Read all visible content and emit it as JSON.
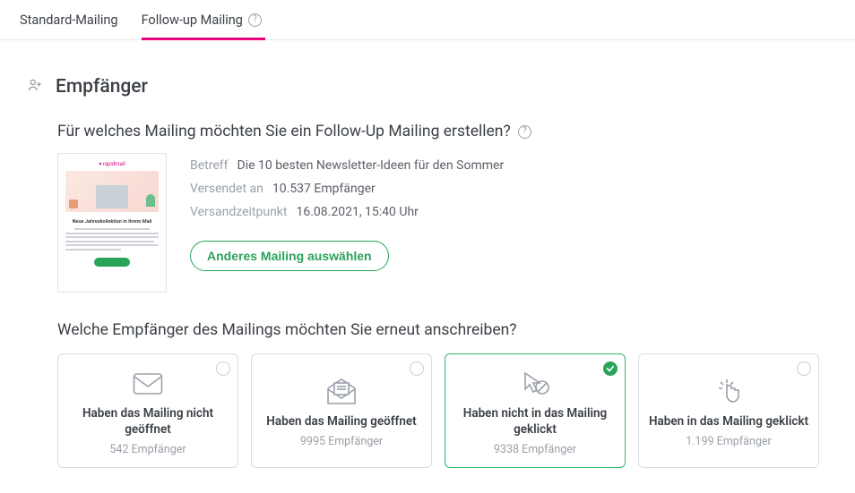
{
  "tabs": {
    "standard": "Standard-Mailing",
    "followup": "Follow-up Mailing"
  },
  "section": {
    "title": "Empfänger"
  },
  "question1": "Für welches Mailing möchten Sie ein Follow-Up Mailing erstellen?",
  "mailing": {
    "betreff_label": "Betreff",
    "betreff_value": "Die 10 besten Newsletter-Ideen für den Sommer",
    "versendet_label": "Versendet an",
    "versendet_value": "10.537 Empfänger",
    "zeit_label": "Versandzeitpunkt",
    "zeit_value": "16.08.2021, 15:40 Uhr",
    "choose_btn": "Anderes Mailing auswählen",
    "preview_headline": "Neue Jahreskollektion in Ihrem Mail"
  },
  "question2": "Welche Empfänger des Mailings möchten Sie erneut anschreiben?",
  "cards": [
    {
      "title": "Haben das Mailing nicht geöffnet",
      "sub": "542 Empfänger",
      "selected": false
    },
    {
      "title": "Haben das Mailing geöffnet",
      "sub": "9995 Empfänger",
      "selected": false
    },
    {
      "title": "Haben nicht in das Mailing geklickt",
      "sub": "9338 Empfänger",
      "selected": true
    },
    {
      "title": "Haben in das Mailing geklickt",
      "sub": "1.199 Empfänger",
      "selected": false
    }
  ],
  "colors": {
    "accent_pink": "#e6007e",
    "accent_green": "#2aa35a",
    "muted": "#9aa0a8"
  }
}
